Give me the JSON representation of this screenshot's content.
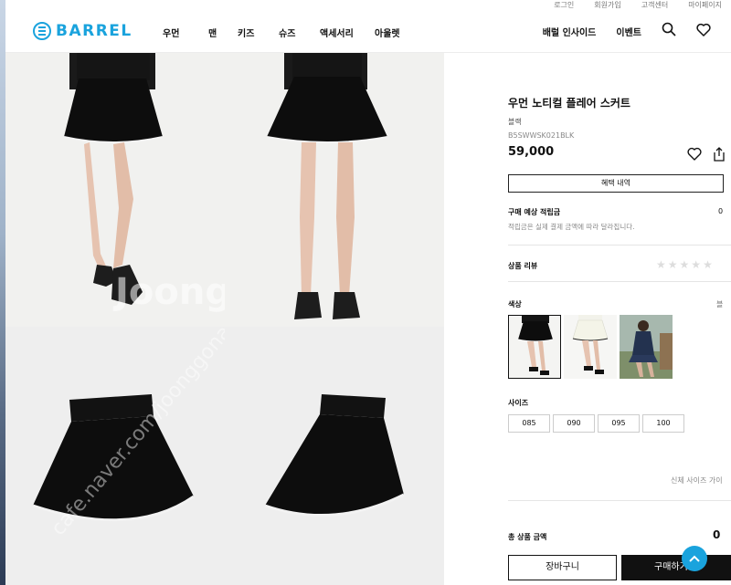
{
  "util_links": [
    "로그인",
    "회원가입",
    "고객센터",
    "마이페이지"
  ],
  "brand": {
    "logo_text": "BARREL",
    "accent": "#1aa3dd"
  },
  "nav": {
    "items": [
      "우먼",
      "맨",
      "키즈",
      "슈즈",
      "액세서리",
      "아울렛"
    ],
    "right": {
      "insight": "배럴 인사이드",
      "event": "이벤트"
    },
    "icons": [
      "search-icon",
      "heart-icon"
    ]
  },
  "gallery": {
    "watermark": "Joonggon",
    "watermark_url": "cafe.naver.com/joonggonara"
  },
  "product": {
    "title": "우먼 노티컬 플레어 스커트",
    "color_name": "블랙",
    "sku": "B5SWWSK021BLK",
    "price": "59,000",
    "benefit_button": "혜택 내역",
    "point_label": "구매 예상 적립금",
    "point_value": "0",
    "point_note": "적립금은 실제 결제 금액에 따라 달라집니다.",
    "review_label": "상품 리뷰",
    "rating": 0,
    "color_label": "색상",
    "color_selected": "블",
    "size_label": "사이즈",
    "sizes": [
      "085",
      "090",
      "095",
      "100"
    ],
    "size_guide": "신체 사이즈 가이",
    "total_label": "총 상품 금액",
    "total_value": "0",
    "cart_button": "장바구니",
    "buy_button": "구매하기"
  }
}
